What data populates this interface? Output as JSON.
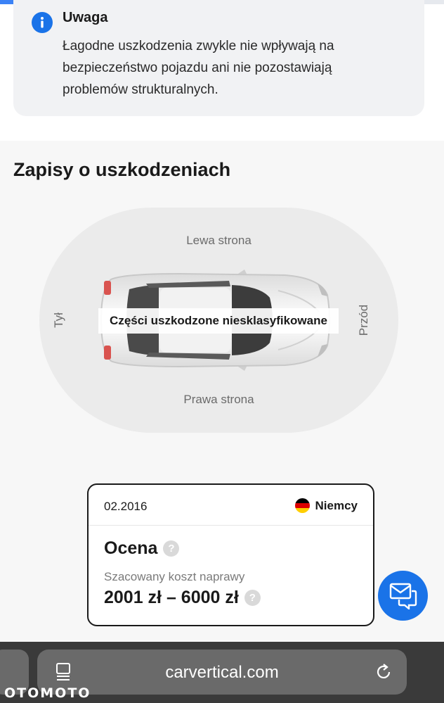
{
  "progress": {
    "fraction": 0.33,
    "color": "#3b82f6"
  },
  "notice": {
    "icon": "info-icon",
    "title": "Uwaga",
    "text": "Łagodne uszkodzenia zwykle nie wpływają na bezpieczeństwo pojazdu ani nie pozostawiają problemów strukturalnych."
  },
  "damage_section": {
    "title": "Zapisy o uszkodzeniach",
    "sides": {
      "left": "Lewa strona",
      "right": "Prawa strona",
      "rear": "Tył",
      "front": "Przód"
    },
    "badge": "Części uszkodzone niesklasyfikowane"
  },
  "record": {
    "date": "02.2016",
    "country": "Niemcy",
    "flag_icon": "germany-flag-icon",
    "rating_label": "Ocena",
    "help_glyph": "?",
    "cost_label": "Szacowany koszt naprawy",
    "cost_value": "2001 zł – 6000 zł"
  },
  "chat_button": {
    "icon": "chat-icon",
    "color": "#1a73e8"
  },
  "browser": {
    "url": "carvertical.com",
    "reader_icon": "reader-mode-icon",
    "reload_icon": "reload-icon"
  },
  "watermark": "OTOMOTO"
}
